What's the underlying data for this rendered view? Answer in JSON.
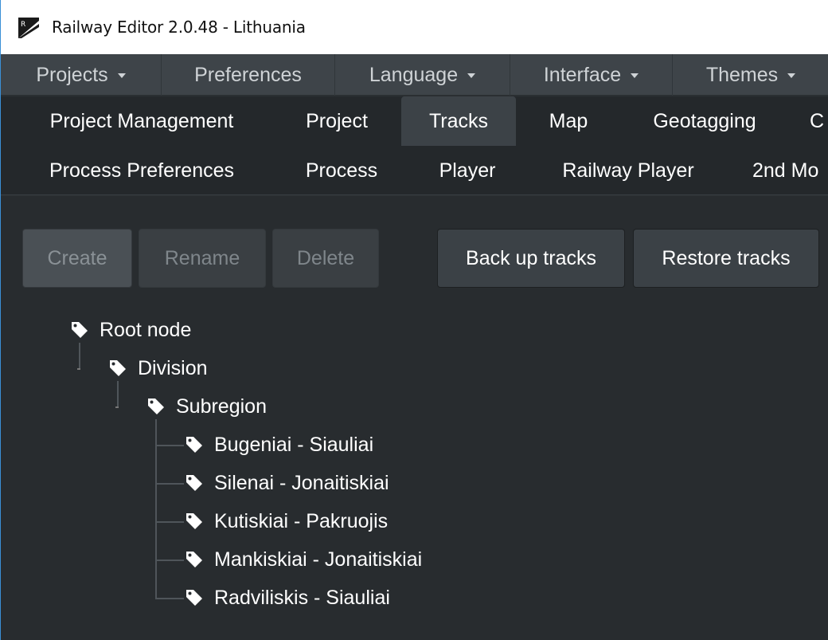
{
  "window": {
    "title": "Railway Editor 2.0.48 - Lithuania"
  },
  "navbar": {
    "items": [
      {
        "label": "Projects",
        "dropdown": true
      },
      {
        "label": "Preferences",
        "dropdown": false
      },
      {
        "label": "Language",
        "dropdown": true
      },
      {
        "label": "Interface",
        "dropdown": true
      },
      {
        "label": "Themes",
        "dropdown": true
      }
    ]
  },
  "tabs": {
    "row1": [
      "Project Management",
      "Project",
      "Tracks",
      "Map",
      "Geotagging",
      "C"
    ],
    "row2": [
      "Process Preferences",
      "Process",
      "Player",
      "Railway Player",
      "2nd Mo"
    ],
    "active": "Tracks"
  },
  "toolbar": {
    "create": "Create",
    "rename": "Rename",
    "delete": "Delete",
    "backup": "Back up tracks",
    "restore": "Restore tracks"
  },
  "tree": {
    "root": "Root node",
    "division": "Division",
    "subregion": "Subregion",
    "tracks": [
      "Bugeniai - Siauliai",
      "Silenai - Jonaitiskiai",
      "Kutiskiai - Pakruojis",
      "Mankiskiai - Jonaitiskiai",
      "Radviliskis - Siauliai"
    ]
  },
  "colors": {
    "navbar": "#3e4449",
    "tabs_bg": "#24282b",
    "content_bg": "#282c2f",
    "active_tab": "#3c4247"
  }
}
